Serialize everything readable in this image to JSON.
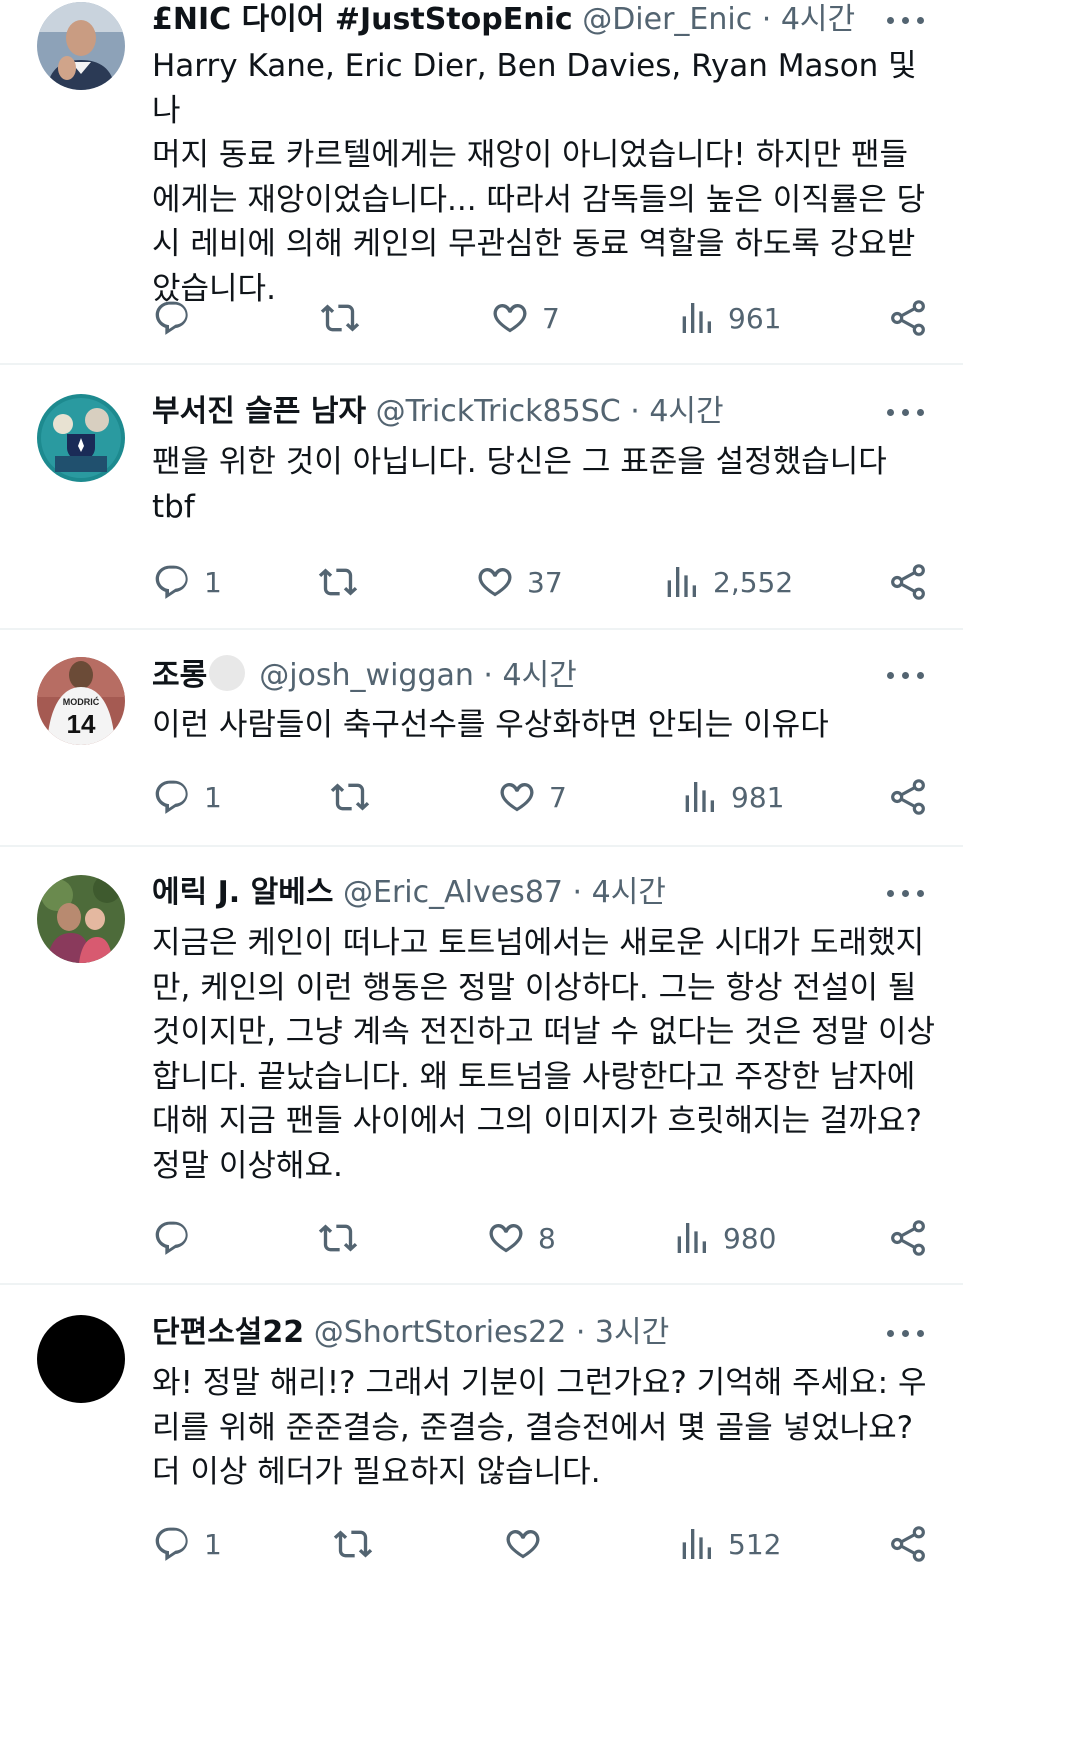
{
  "tweets": [
    {
      "name": "£NIC 다이어 #JustStopEnic",
      "handle": "@Dier_Enic",
      "time": "4시간",
      "text": "Harry Kane, Eric Dier, Ben Davies, Ryan Mason 및 나\n머지 동료 카르텔에게는 재앙이 아니었습니다! 하지만 팬들\n에게는 재앙이었습니다... 따라서 감독들의 높은 이직률은 당\n시 레비에 의해 케인의 무관심한 동료 역할을 하도록 강요받\n았습니다.",
      "replies": "",
      "retweets": "",
      "likes": "7",
      "views": "961",
      "avatar_icon": "bald-man-clapping-avatar"
    },
    {
      "name": "부서진 슬픈 남자",
      "handle": "@TrickTrick85SC",
      "time": "4시간",
      "text": "팬을 위한 것이 아닙니다. 당신은 그 표준을 설정했습니다\ntbf",
      "replies": "1",
      "retweets": "",
      "likes": "37",
      "views": "2,552",
      "avatar_icon": "spurs-crest-avatar"
    },
    {
      "name": "조롱",
      "handle": "@josh_wiggan",
      "time": "4시간",
      "text": "이런 사람들이 축구선수를 우상화하면 안되는 이유다",
      "replies": "1",
      "retweets": "",
      "likes": "7",
      "views": "981",
      "avatar_icon": "modric-14-shirt-avatar"
    },
    {
      "name": "에릭 J. 알베스",
      "handle": "@Eric_Alves87",
      "time": "4시간",
      "text": "지금은 케인이 떠나고 토트넘에서는 새로운 시대가 도래했지\n만, 케인의 이런 행동은 정말 이상하다. 그는 항상 전설이 될\n것이지만, 그냥 계속 전진하고 떠날 수 없다는 것은 정말 이상\n합니다. 끝났습니다. 왜 토트넘을 사랑한다고 주장한 남자에\n대해 지금 팬들 사이에서 그의 이미지가 흐릿해지는 걸까요?\n정말 이상해요.",
      "replies": "",
      "retweets": "",
      "likes": "8",
      "views": "980",
      "avatar_icon": "father-with-child-avatar"
    },
    {
      "name": "단편소설22",
      "handle": "@ShortStories22",
      "time": "3시간",
      "text": "와! 정말 해리!? 그래서 기분이 그런가요? 기억해 주세요: 우\n리를 위해 준준결승, 준결승, 결승전에서 몇 골을 넣었나요?\n더 이상 헤더가 필요하지 않습니다.",
      "replies": "1",
      "retweets": "",
      "likes": "",
      "views": "512",
      "avatar_icon": "black-circle-avatar"
    }
  ],
  "icons": {
    "reply": "reply-icon",
    "retweet": "retweet-icon",
    "like": "heart-icon",
    "views": "views-icon",
    "share": "share-icon",
    "more": "more-icon"
  },
  "colors": {
    "text": "#0f1419",
    "secondary": "#536471",
    "divider": "#eff3f4"
  }
}
